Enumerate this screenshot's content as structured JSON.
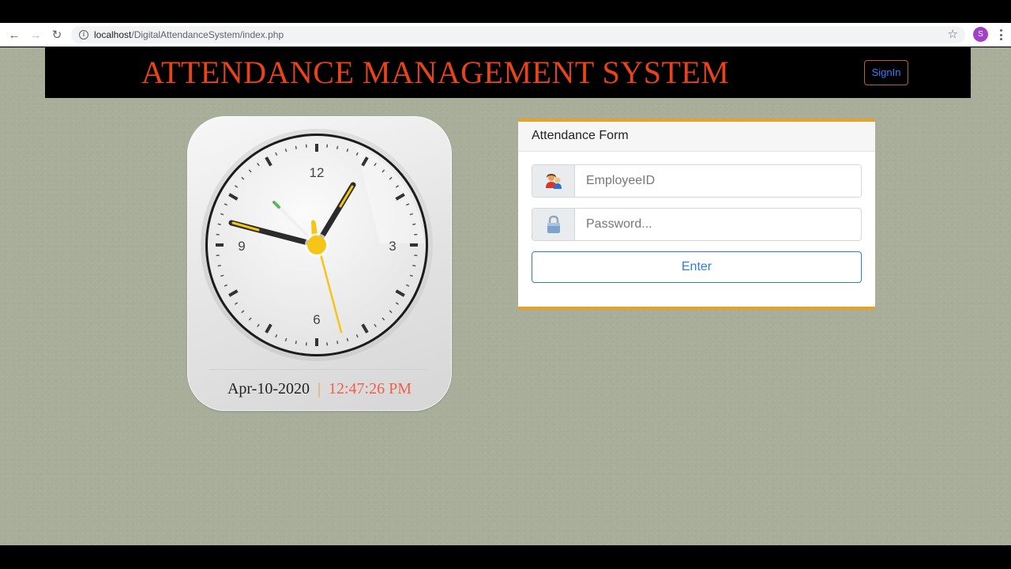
{
  "browser": {
    "url_host": "localhost",
    "url_path": "/DigitalAttendanceSystem/index.php",
    "profile_initial": "S"
  },
  "header": {
    "title": "ATTENDANCE MANAGEMENT SYSTEM",
    "signin_label": "SignIn",
    "title_color": "#e8431b"
  },
  "clock": {
    "numerals": {
      "twelve": "12",
      "three": "3",
      "six": "6",
      "nine": "9"
    },
    "date": "Apr-10-2020",
    "separator": "|",
    "time": "12:47:26 PM",
    "accent_color": "#f5c518"
  },
  "form": {
    "title": "Attendance Form",
    "employee_placeholder": "EmployeeID",
    "password_placeholder": "Password...",
    "enter_label": "Enter",
    "accent_color": "#e5a12a"
  }
}
